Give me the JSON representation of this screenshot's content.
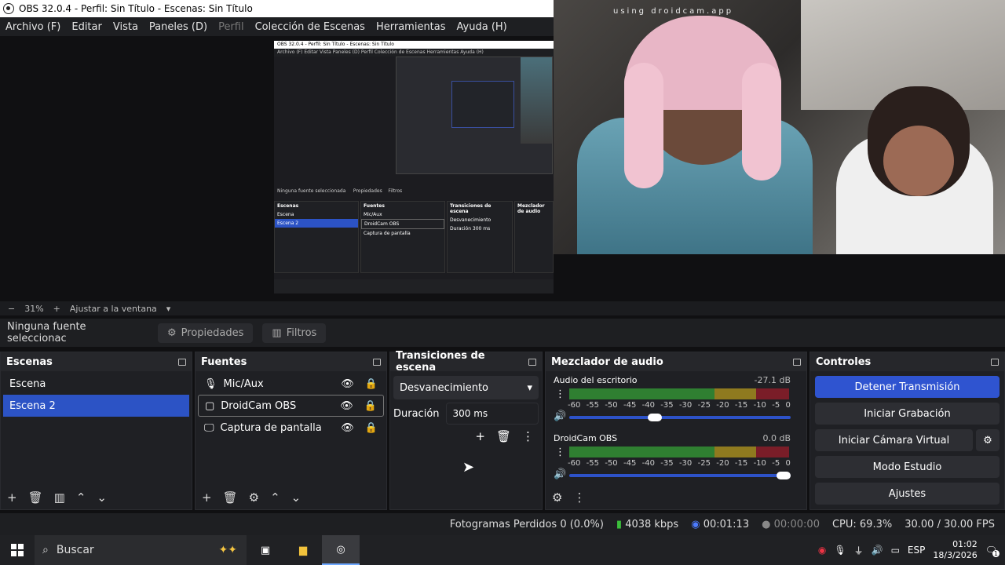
{
  "window": {
    "title": "OBS 32.0.4 - Perfil: Sin Título - Escenas: Sin Título"
  },
  "menu": [
    "Archivo (F)",
    "Editar",
    "Vista",
    "Paneles (D)",
    "Perfil",
    "Colección de Escenas",
    "Herramientas",
    "Ayuda (H)"
  ],
  "preview": {
    "watermark": "using droidcam.app",
    "zoom": "31%",
    "fit_label": "Ajustar a la ventana",
    "nested_title": "OBS 32.0.4 - Perfil: Sin Título - Escenas: Sin Título"
  },
  "source_bar": {
    "no_selection": "Ninguna fuente seleccionac",
    "properties": "Propiedades",
    "filters": "Filtros"
  },
  "scenes": {
    "title": "Escenas",
    "items": [
      "Escena",
      "Escena 2"
    ],
    "selected_index": 1
  },
  "sources": {
    "title": "Fuentes",
    "items": [
      {
        "name": "Mic/Aux",
        "icon": "mic-icon"
      },
      {
        "name": "DroidCam OBS",
        "icon": "camera-icon"
      },
      {
        "name": "Captura de pantalla",
        "icon": "monitor-icon"
      }
    ]
  },
  "transitions": {
    "title": "Transiciones de escena",
    "selected": "Desvanecimiento",
    "duration_label": "Duración",
    "duration": "300 ms"
  },
  "mixer": {
    "title": "Mezclador de audio",
    "channels": [
      {
        "name": "Audio del escritorio",
        "db": "-27.1 dB",
        "volume": 0.38
      },
      {
        "name": "DroidCam OBS",
        "db": "0.0 dB",
        "volume": 1.0
      }
    ],
    "scale": [
      "-60",
      "-55",
      "-50",
      "-45",
      "-40",
      "-35",
      "-30",
      "-25",
      "-20",
      "-15",
      "-10",
      "-5",
      "0"
    ]
  },
  "controls": {
    "title": "Controles",
    "stop_stream": "Detener Transmisión",
    "start_recording": "Iniciar Grabación",
    "virtual_cam": "Iniciar Cámara Virtual",
    "studio_mode": "Modo Estudio",
    "settings": "Ajustes"
  },
  "status": {
    "dropped": "Fotogramas Perdidos 0 (0.0%)",
    "bitrate": "4038 kbps",
    "stream_time": "00:01:13",
    "rec_time": "00:00:00",
    "cpu": "CPU: 69.3%",
    "fps": "30.00 / 30.00 FPS"
  },
  "taskbar": {
    "search": "Buscar",
    "lang": "ESP",
    "time": "01:02",
    "date": "18/3/2026",
    "notif_count": "1"
  },
  "colors": {
    "accent": "#2f54d0",
    "panel": "#1f2024",
    "bg": "#101012"
  }
}
